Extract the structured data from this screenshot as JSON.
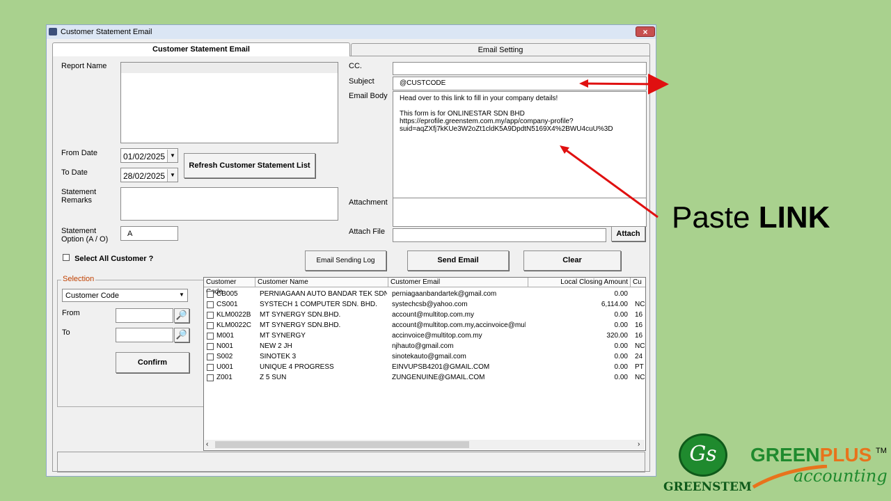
{
  "window": {
    "title": "Customer Statement Email",
    "close_label": "×"
  },
  "tabs": [
    {
      "label": "Customer Statement Email"
    },
    {
      "label": "Email Setting"
    }
  ],
  "left": {
    "report_name_label": "Report Name",
    "from_date_label": "From Date",
    "from_date": "01/02/2025",
    "to_date_label": "To Date",
    "to_date": "28/02/2025",
    "refresh_button": "Refresh Customer Statement List",
    "remarks_label": "Statement\nRemarks",
    "option_label": "Statement\nOption (A / O)",
    "option_value": "A",
    "select_all_label": "Select All Customer ?"
  },
  "email": {
    "cc_label": "CC.",
    "subject_label": "Subject",
    "subject_value": "@CUSTCODE",
    "body_label": "Email Body",
    "body_line1": "Head over to this link to fill in your company details!",
    "body_line2": "This form is for ONLINESTAR SDN BHD",
    "body_line3": "https://eprofile.greenstem.com.my/app/company-profile?",
    "body_line4": "suid=aqZXfj7kKUe3W2oZt1cldK5A9DpdtN5169X4%2BWU4cuU%3D",
    "attachment_label": "Attachment",
    "attach_file_label": "Attach File",
    "attach_button": "Attach"
  },
  "actions": {
    "log_button": "Email Sending Log",
    "send_button": "Send Email",
    "clear_button": "Clear"
  },
  "selection": {
    "legend": "Selection",
    "field_value": "Customer Code",
    "from_label": "From",
    "to_label": "To",
    "confirm_button": "Confirm"
  },
  "grid": {
    "columns": [
      "Customer Code",
      "Customer Name",
      "Customer Email",
      "Local Closing Amount",
      "Cu"
    ],
    "rows": [
      {
        "code": "CB005",
        "name": "PERNIAGAAN AUTO BANDAR TEK SDN B...",
        "email": "perniagaanbandartek@gmail.com",
        "amount": "0.00",
        "cu": ""
      },
      {
        "code": "CS001",
        "name": "SYSTECH 1 COMPUTER SDN. BHD.",
        "email": "systechcsb@yahoo.com",
        "amount": "6,114.00",
        "cu": "NC"
      },
      {
        "code": "KLM0022B",
        "name": "MT SYNERGY SDN.BHD.",
        "email": "account@multitop.com.my",
        "amount": "0.00",
        "cu": "16"
      },
      {
        "code": "KLM0022C",
        "name": "MT SYNERGY SDN.BHD.",
        "email": "account@multitop.com.my,accinvoice@multi",
        "amount": "0.00",
        "cu": "16"
      },
      {
        "code": "M001",
        "name": "MT SYNERGY",
        "email": "accinvoice@multitop.com.my",
        "amount": "320.00",
        "cu": "16"
      },
      {
        "code": "N001",
        "name": "NEW 2 JH",
        "email": "njhauto@gmail.com",
        "amount": "0.00",
        "cu": "NC"
      },
      {
        "code": "S002",
        "name": "SINOTEK 3",
        "email": "sinotekauto@gmail.com",
        "amount": "0.00",
        "cu": "24"
      },
      {
        "code": "U001",
        "name": "UNIQUE 4 PROGRESS",
        "email": "EINVUPSB4201@GMAIL.COM",
        "amount": "0.00",
        "cu": "PT"
      },
      {
        "code": "Z001",
        "name": "Z 5 SUN",
        "email": "ZUNGENUINE@GMAIL.COM",
        "amount": "0.00",
        "cu": "NC"
      }
    ]
  },
  "annotation": {
    "paste_prefix": "Paste ",
    "paste_bold": "LINK",
    "arrow_color": "#e01010"
  },
  "logos": {
    "greenstem_mark": "Gs",
    "greenstem_text": "GREENSTEM",
    "greenplus_green": "GREEN",
    "greenplus_orange": "PLUS",
    "tm": "TM",
    "accounting": "accounting"
  }
}
